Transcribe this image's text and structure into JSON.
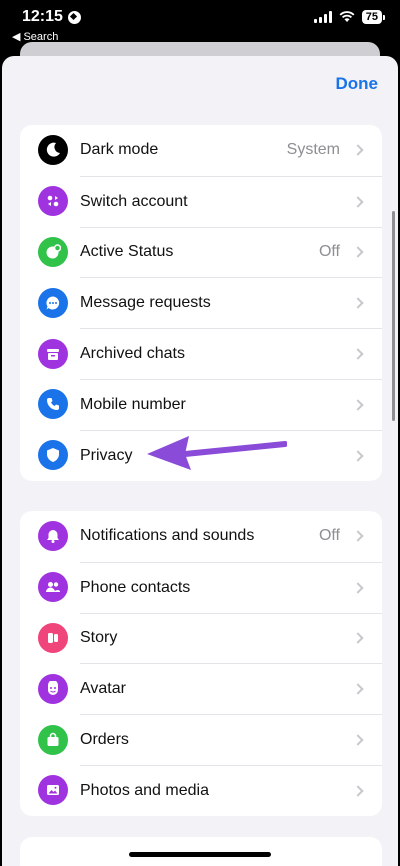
{
  "status_bar": {
    "time": "12:15",
    "back_label": "Search",
    "battery": "75"
  },
  "header": {
    "done_label": "Done"
  },
  "group1": [
    {
      "name": "dark-mode",
      "label": "Dark mode",
      "value": "System",
      "icon": "moon-icon",
      "color": "#000000"
    },
    {
      "name": "switch-account",
      "label": "Switch account",
      "value": "",
      "icon": "switch-account-icon",
      "color": "#a033e0"
    },
    {
      "name": "active-status",
      "label": "Active Status",
      "value": "Off",
      "icon": "active-status-icon",
      "color": "#31c24a"
    },
    {
      "name": "message-requests",
      "label": "Message requests",
      "value": "",
      "icon": "message-requests-icon",
      "color": "#1a73e8"
    },
    {
      "name": "archived-chats",
      "label": "Archived chats",
      "value": "",
      "icon": "archive-icon",
      "color": "#a033e0"
    },
    {
      "name": "mobile-number",
      "label": "Mobile number",
      "value": "",
      "icon": "phone-icon",
      "color": "#1a73e8"
    },
    {
      "name": "privacy",
      "label": "Privacy",
      "value": "",
      "icon": "shield-icon",
      "color": "#1a73e8"
    }
  ],
  "group2": [
    {
      "name": "notifications-and-sounds",
      "label": "Notifications and sounds",
      "value": "Off",
      "icon": "bell-icon",
      "color": "#a033e0"
    },
    {
      "name": "phone-contacts",
      "label": "Phone contacts",
      "value": "",
      "icon": "contacts-icon",
      "color": "#a033e0"
    },
    {
      "name": "story",
      "label": "Story",
      "value": "",
      "icon": "story-icon",
      "color": "#f0457a"
    },
    {
      "name": "avatar",
      "label": "Avatar",
      "value": "",
      "icon": "avatar-icon",
      "color": "#a033e0"
    },
    {
      "name": "orders",
      "label": "Orders",
      "value": "",
      "icon": "bag-icon",
      "color": "#31c24a"
    },
    {
      "name": "photos-and-media",
      "label": "Photos and media",
      "value": "",
      "icon": "photo-icon",
      "color": "#a033e0"
    }
  ],
  "annotation": {
    "arrow_color": "#8a4bd8",
    "target": "privacy"
  }
}
